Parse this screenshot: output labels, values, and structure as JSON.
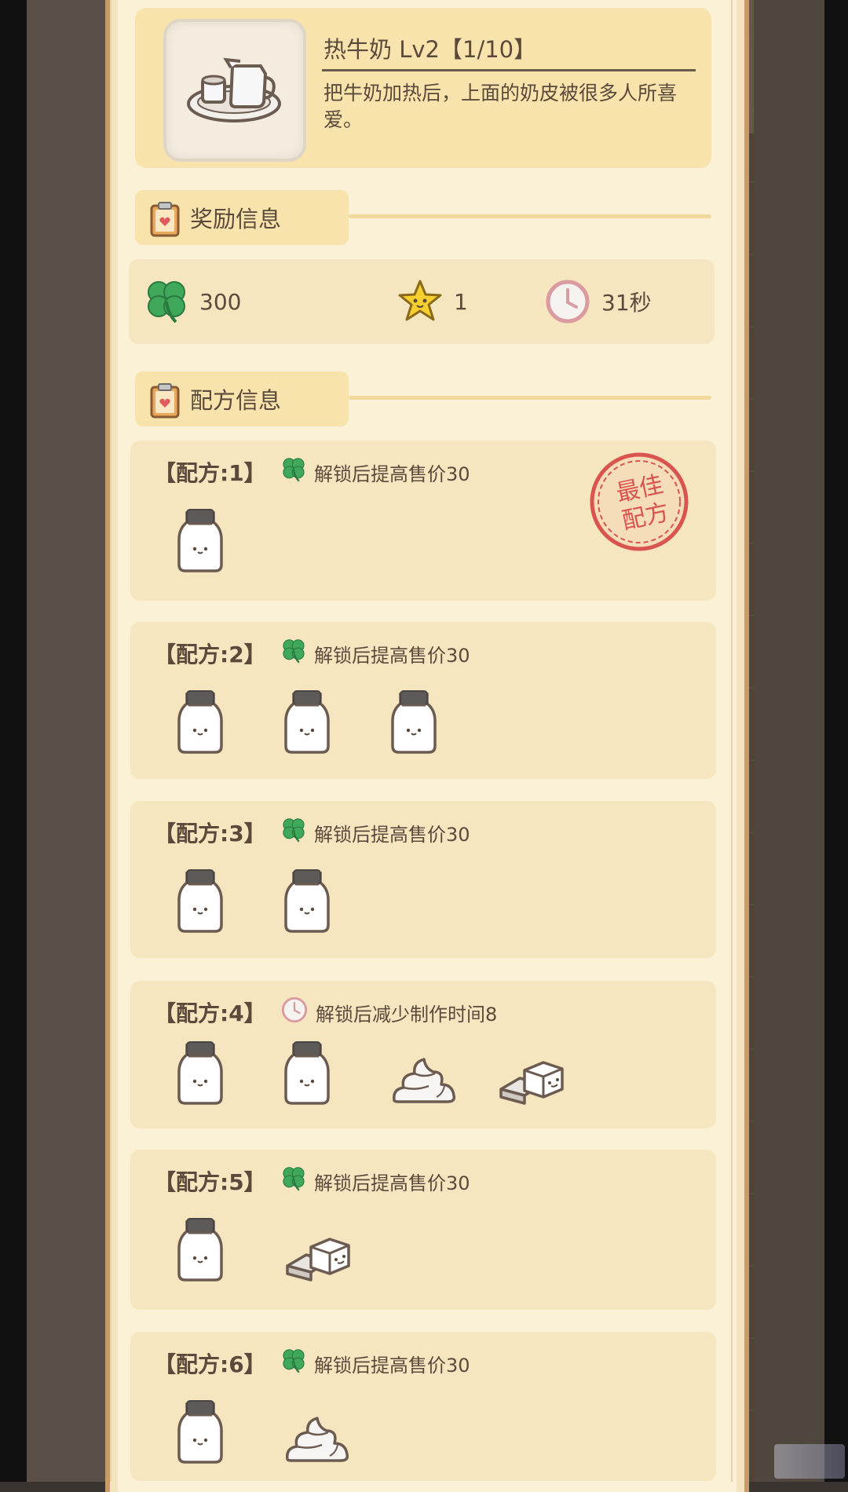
{
  "item": {
    "title": "热牛奶 Lv2【1/10】",
    "description": "把牛奶加热后，上面的奶皮被很多人所喜爱。",
    "icon": "hot-milk-tray-icon"
  },
  "sections": {
    "reward_label": "奖励信息",
    "recipe_label": "配方信息"
  },
  "rewards": {
    "clover_value": "300",
    "star_value": "1",
    "time_value": "31秒"
  },
  "recipes": [
    {
      "name": "【配方:1】",
      "bonus_icon": "clover-icon",
      "bonus_text": "解锁后提高售价30",
      "ingredients": [
        "milk"
      ],
      "best": true
    },
    {
      "name": "【配方:2】",
      "bonus_icon": "clover-icon",
      "bonus_text": "解锁后提高售价30",
      "ingredients": [
        "milk",
        "milk",
        "milk"
      ],
      "best": false
    },
    {
      "name": "【配方:3】",
      "bonus_icon": "clover-icon",
      "bonus_text": "解锁后提高售价30",
      "ingredients": [
        "milk",
        "milk"
      ],
      "best": false
    },
    {
      "name": "【配方:4】",
      "bonus_icon": "clock-icon",
      "bonus_text": "解锁后减少制作时间8",
      "ingredients": [
        "milk",
        "milk",
        "cream",
        "butter"
      ],
      "best": false
    },
    {
      "name": "【配方:5】",
      "bonus_icon": "clover-icon",
      "bonus_text": "解锁后提高售价30",
      "ingredients": [
        "milk",
        "butter"
      ],
      "best": false
    },
    {
      "name": "【配方:6】",
      "bonus_icon": "clover-icon",
      "bonus_text": "解锁后提高售价30",
      "ingredients": [
        "milk",
        "cream"
      ],
      "best": false
    }
  ],
  "stamp": {
    "text_line1": "最佳",
    "text_line2": "配方"
  },
  "colors": {
    "panel": "#fbf1d6",
    "card": "#f6e6bf",
    "header": "#f7e3ab",
    "text": "#5b4a3c",
    "clover": "#3fa85a",
    "stamp": "#d9534f"
  }
}
